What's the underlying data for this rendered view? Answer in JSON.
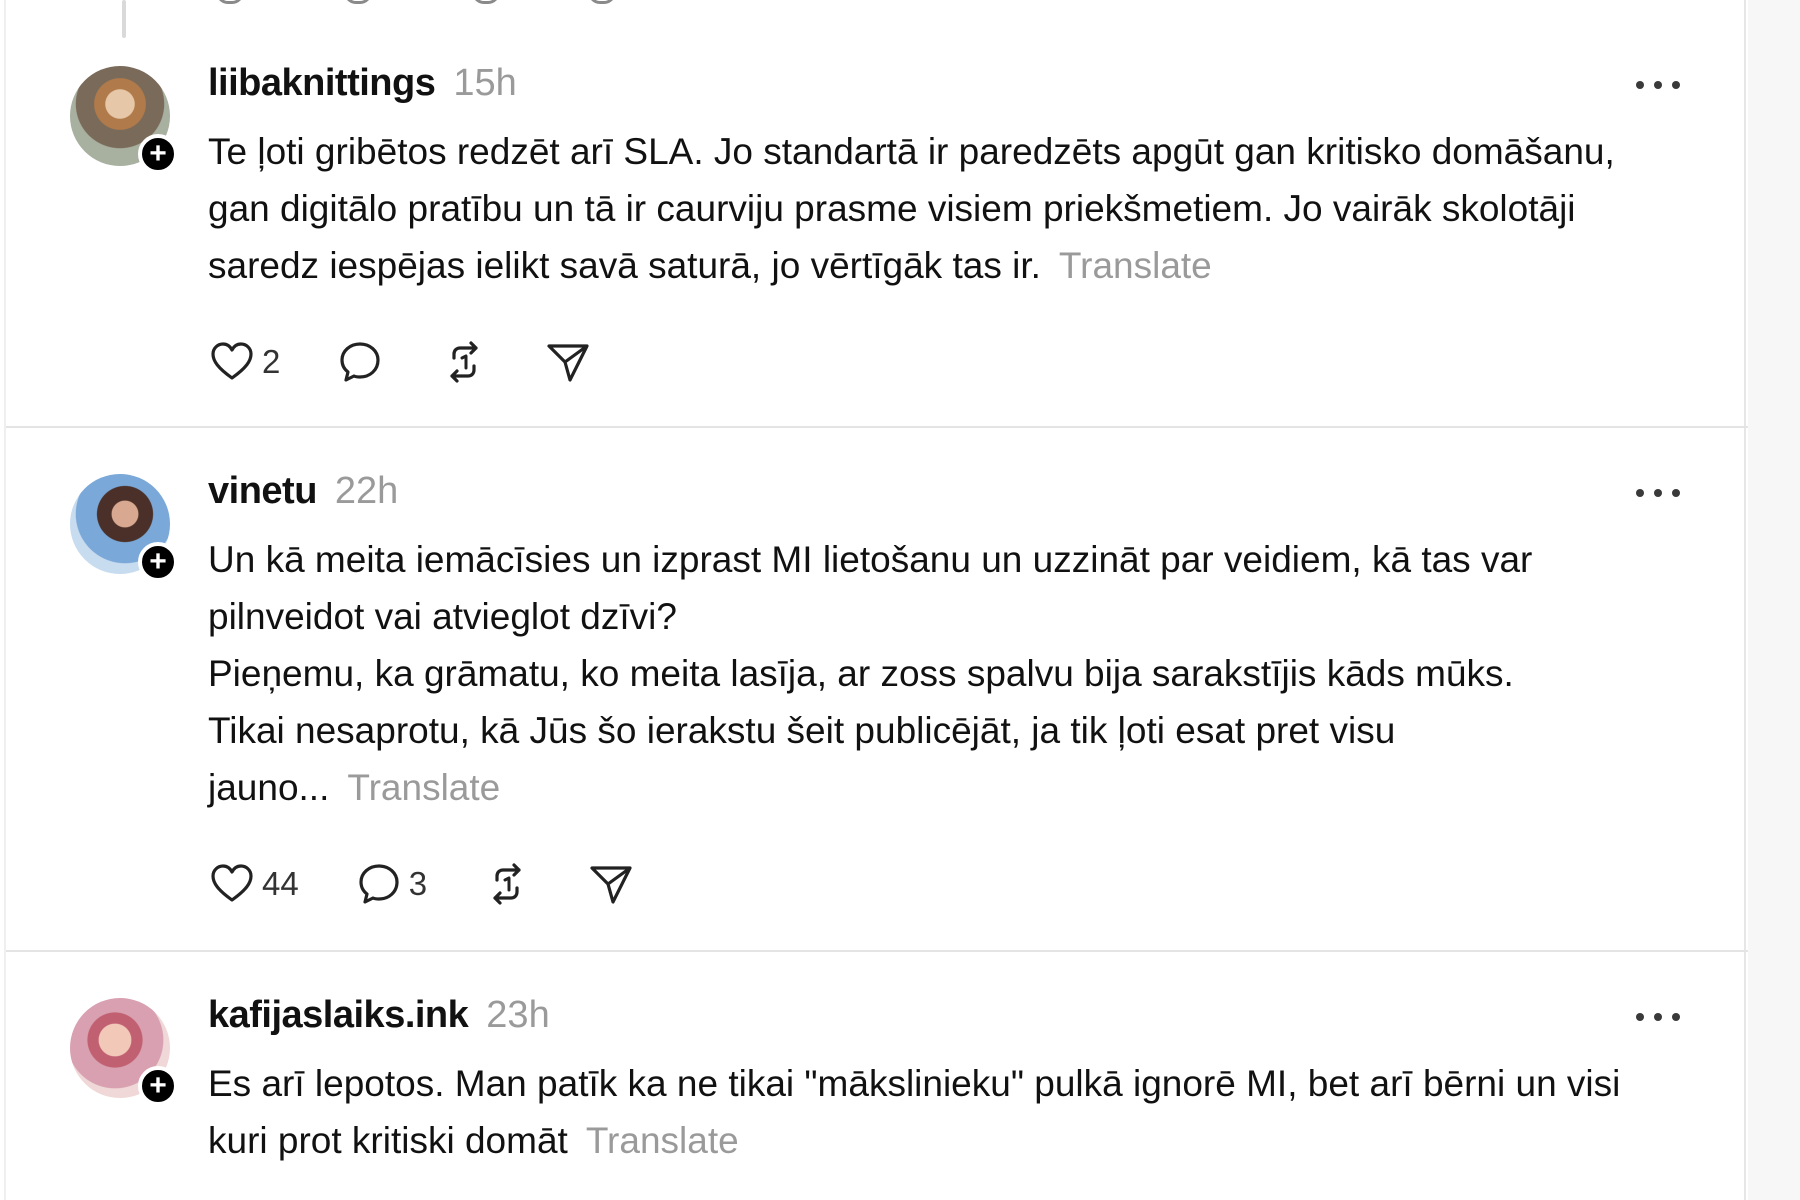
{
  "posts": [
    {
      "username": "liibaknittings",
      "time": "15h",
      "text": "Te ļoti gribētos redzēt arī SLA. Jo standartā ir paredzēts apgūt gan kritisko domāšanu, gan digitālo pratību un tā ir caurviju prasme visiem priekšmetiem. Jo vairāk skolotāji saredz iespējas ielikt savā saturā, jo vērtīgāk tas ir.",
      "translate_label": "Translate",
      "likes": "2",
      "replies": ""
    },
    {
      "username": "vinetu",
      "time": "22h",
      "text_lines": [
        "Un kā meita iemācīsies un izprast MI lietošanu un uzzināt par veidiem, kā tas var pilnveidot vai atvieglot dzīvi?",
        "Pieņemu, ka grāmatu, ko meita lasīja, ar zoss spalvu bija sarakstījis kāds mūks.",
        "Tikai nesaprotu, kā Jūs šo ierakstu šeit publicējāt, ja tik ļoti esat pret visu jauno..."
      ],
      "translate_label": "Translate",
      "likes": "44",
      "replies": "3"
    },
    {
      "username": "kafijaslaiks.ink",
      "time": "23h",
      "text": "Es arī lepotos. Man patīk ka ne tikai \"mākslinieku\" pulkā ignorē MI, bet arī bērni un visi kuri prot kritiski domāt",
      "translate_label": "Translate"
    }
  ],
  "icons": {
    "like": "heart-icon",
    "reply": "comment-icon",
    "repost": "repost-icon",
    "share": "send-icon",
    "more": "more-icon",
    "follow": "plus-icon"
  },
  "colors": {
    "text": "#111111",
    "muted": "#9a9a9a",
    "divider": "#e4e4e4"
  }
}
